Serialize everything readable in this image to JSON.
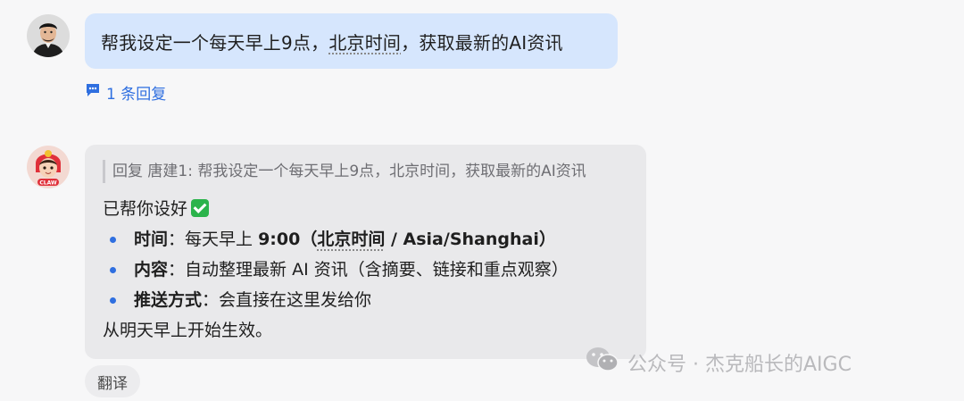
{
  "user_message": {
    "part1": "帮我设定一个每天早上9点，",
    "part2": "北京时间",
    "part3": "，获取最新的AI资讯"
  },
  "reply_count_label": "1 条回复",
  "bot_message": {
    "quote": "回复 唐建1: 帮我设定一个每天早上9点，北京时间，获取最新的AI资讯",
    "intro": "已帮你设好",
    "items": [
      {
        "label": "时间",
        "sep": "：",
        "text_before": "每天早上 ",
        "text_bold": "9:00（",
        "text_bold_dotted": "北京时间",
        "text_bold_after": " / Asia/Shanghai）"
      },
      {
        "label": "内容",
        "sep": "：",
        "text": "自动整理最新 AI 资讯（含摘要、链接和重点观察）"
      },
      {
        "label": "推送方式",
        "sep": "：",
        "text": "会直接在这里发给你"
      }
    ],
    "outro": "从明天早上开始生效。"
  },
  "bot_avatar_badge": "CLAW",
  "translate_label": "翻译",
  "watermark": "公众号 · 杰克船长的AIGC",
  "colors": {
    "user_bubble": "#d6e6fd",
    "bot_bubble": "#e9e9eb",
    "accent_blue": "#2f6fe0",
    "check_green": "#2bb34b"
  }
}
